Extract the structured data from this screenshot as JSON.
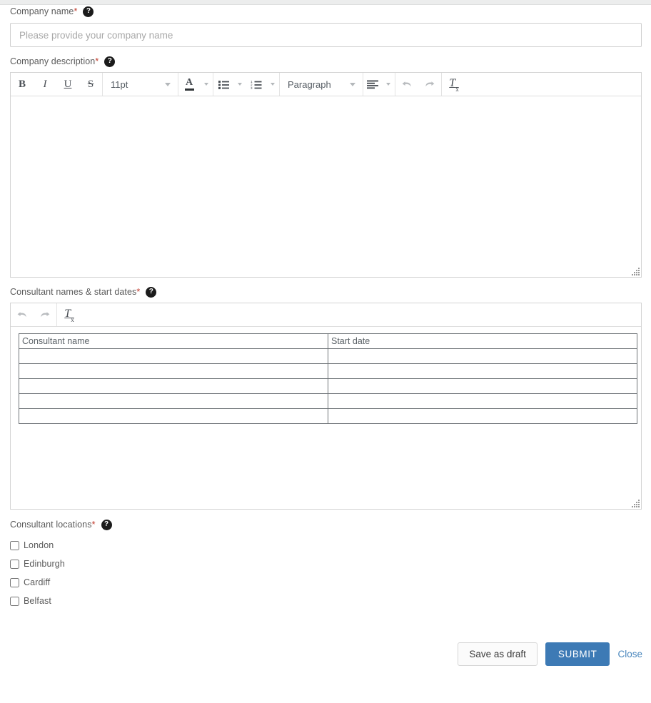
{
  "form": {
    "company_name": {
      "label": "Company name",
      "required_mark": "*",
      "help_icon": "question-mark-icon",
      "help_glyph": "?",
      "placeholder": "Please provide your company name",
      "value": ""
    },
    "company_description": {
      "label": "Company description",
      "required_mark": "*",
      "help_glyph": "?",
      "value": "",
      "toolbar": {
        "bold": "B",
        "italic": "I",
        "underline": "U",
        "strikethrough": "S",
        "font_size": "11pt",
        "text_color": "A",
        "bullet_list": "bullet-list-icon",
        "numbered_list": "numbered-list-icon",
        "block_format": "Paragraph",
        "align": "align-left-icon",
        "undo": "undo-icon",
        "redo": "redo-icon",
        "clear_format": "T",
        "clear_format_sub": "x"
      }
    },
    "consultant_names": {
      "label": "Consultant names & start dates",
      "required_mark": "*",
      "help_glyph": "?",
      "toolbar": {
        "undo": "undo-icon",
        "redo": "redo-icon",
        "clear_format": "T",
        "clear_format_sub": "x"
      },
      "table": {
        "headers": [
          "Consultant name",
          "Start date"
        ],
        "rows": [
          [
            "",
            ""
          ],
          [
            "",
            ""
          ],
          [
            "",
            ""
          ],
          [
            "",
            ""
          ],
          [
            "",
            ""
          ]
        ]
      }
    },
    "consultant_locations": {
      "label": "Consultant locations",
      "required_mark": "*",
      "help_glyph": "?",
      "options": [
        {
          "label": "London",
          "checked": false
        },
        {
          "label": "Edinburgh",
          "checked": false
        },
        {
          "label": "Cardiff",
          "checked": false
        },
        {
          "label": "Belfast",
          "checked": false
        }
      ]
    }
  },
  "footer": {
    "save_draft_label": "Save as draft",
    "submit_label": "SUBMIT",
    "close_label": "Close"
  },
  "colors": {
    "primary": "#3d7ab5",
    "link": "#4a87bd",
    "required": "#c0392b",
    "label_text": "#5a5a5a",
    "border": "#cfcfcf"
  }
}
